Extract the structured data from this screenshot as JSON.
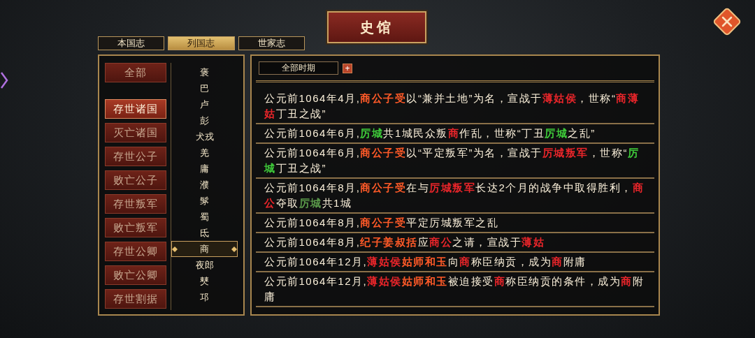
{
  "title": "史馆",
  "tabs": [
    {
      "label": "本国志",
      "selected": false
    },
    {
      "label": "列国志",
      "selected": true
    },
    {
      "label": "世家志",
      "selected": false
    }
  ],
  "categories": [
    {
      "label": "全部",
      "selected": false
    },
    {
      "label": "存世诸国",
      "selected": true
    },
    {
      "label": "灭亡诸国",
      "selected": false
    },
    {
      "label": "存世公子",
      "selected": false
    },
    {
      "label": "败亡公子",
      "selected": false
    },
    {
      "label": "存世叛军",
      "selected": false
    },
    {
      "label": "败亡叛军",
      "selected": false
    },
    {
      "label": "存世公卿",
      "selected": false
    },
    {
      "label": "败亡公卿",
      "selected": false
    },
    {
      "label": "存世割据",
      "selected": false
    }
  ],
  "nations": [
    {
      "label": "褒",
      "selected": false
    },
    {
      "label": "巴",
      "selected": false
    },
    {
      "label": "卢",
      "selected": false
    },
    {
      "label": "彭",
      "selected": false
    },
    {
      "label": "犬戎",
      "selected": false
    },
    {
      "label": "羌",
      "selected": false
    },
    {
      "label": "庸",
      "selected": false
    },
    {
      "label": "濮",
      "selected": false
    },
    {
      "label": "髳",
      "selected": false
    },
    {
      "label": "蜀",
      "selected": false
    },
    {
      "label": "氐",
      "selected": false
    },
    {
      "label": "商",
      "selected": true
    },
    {
      "label": "夜郎",
      "selected": false
    },
    {
      "label": "僰",
      "selected": false
    },
    {
      "label": "邛",
      "selected": false
    }
  ],
  "filter": {
    "value": "全部时期",
    "add_symbol": "+"
  },
  "entries": [
    {
      "segments": [
        {
          "text": "公元前1064年4月,"
        },
        {
          "text": "商公子受",
          "color": "#ff5a28"
        },
        {
          "text": "以“兼并土地”为名，宣战于"
        },
        {
          "text": "薄姑侯",
          "color": "#e8252a"
        },
        {
          "text": "，世称“"
        },
        {
          "text": "商薄姑",
          "color": "#e8252a"
        },
        {
          "text": "丁丑之战”"
        }
      ]
    },
    {
      "segments": [
        {
          "text": "公元前1064年6月,"
        },
        {
          "text": "厉城",
          "color": "#3fcc3a"
        },
        {
          "text": "共1城民众叛"
        },
        {
          "text": "商",
          "color": "#e8252a"
        },
        {
          "text": "作乱，世称“丁丑"
        },
        {
          "text": "厉城",
          "color": "#3fcc3a"
        },
        {
          "text": "之乱”"
        }
      ]
    },
    {
      "segments": [
        {
          "text": "公元前1064年6月,"
        },
        {
          "text": "商公子受",
          "color": "#ff5a28"
        },
        {
          "text": "以“平定叛军”为名，宣战于"
        },
        {
          "text": "厉城叛军",
          "color": "#e8252a"
        },
        {
          "text": "，世称“"
        },
        {
          "text": "厉城",
          "color": "#3fcc3a"
        },
        {
          "text": "丁丑之战”"
        }
      ]
    },
    {
      "segments": [
        {
          "text": "公元前1064年8月,"
        },
        {
          "text": "商公子受",
          "color": "#ff5a28"
        },
        {
          "text": "在与"
        },
        {
          "text": "厉城叛军",
          "color": "#e8252a"
        },
        {
          "text": "长达2个月的战争中取得胜利，"
        },
        {
          "text": "商公",
          "color": "#e8252a"
        },
        {
          "text": "夺取"
        },
        {
          "text": "厉城",
          "color": "#5a9a4a"
        },
        {
          "text": "共1城"
        }
      ]
    },
    {
      "segments": [
        {
          "text": "公元前1064年8月,"
        },
        {
          "text": "商公子受",
          "color": "#ff5a28"
        },
        {
          "text": "平定厉城叛军之乱"
        }
      ]
    },
    {
      "segments": [
        {
          "text": "公元前1064年8月,"
        },
        {
          "text": "纪子姜叔括",
          "color": "#ff5a28"
        },
        {
          "text": "应"
        },
        {
          "text": "商公",
          "color": "#e8252a"
        },
        {
          "text": "之请，宣战于"
        },
        {
          "text": "薄姑",
          "color": "#e8252a"
        }
      ]
    },
    {
      "segments": [
        {
          "text": "公元前1064年12月,"
        },
        {
          "text": "薄姑侯",
          "color": "#e8252a"
        },
        {
          "text": "姑师和玉",
          "color": "#ff5a28"
        },
        {
          "text": "向"
        },
        {
          "text": "商",
          "color": "#e8252a"
        },
        {
          "text": "称臣纳贡，成为"
        },
        {
          "text": "商",
          "color": "#e8252a"
        },
        {
          "text": "附庸"
        }
      ]
    },
    {
      "segments": [
        {
          "text": "公元前1064年12月,"
        },
        {
          "text": "薄姑侯",
          "color": "#e8252a"
        },
        {
          "text": "姑师和玉",
          "color": "#ff5a28"
        },
        {
          "text": "被迫接受"
        },
        {
          "text": "商",
          "color": "#e8252a"
        },
        {
          "text": "称臣纳贡的条件，成为"
        },
        {
          "text": "商",
          "color": "#e8252a"
        },
        {
          "text": "附庸"
        }
      ]
    }
  ]
}
